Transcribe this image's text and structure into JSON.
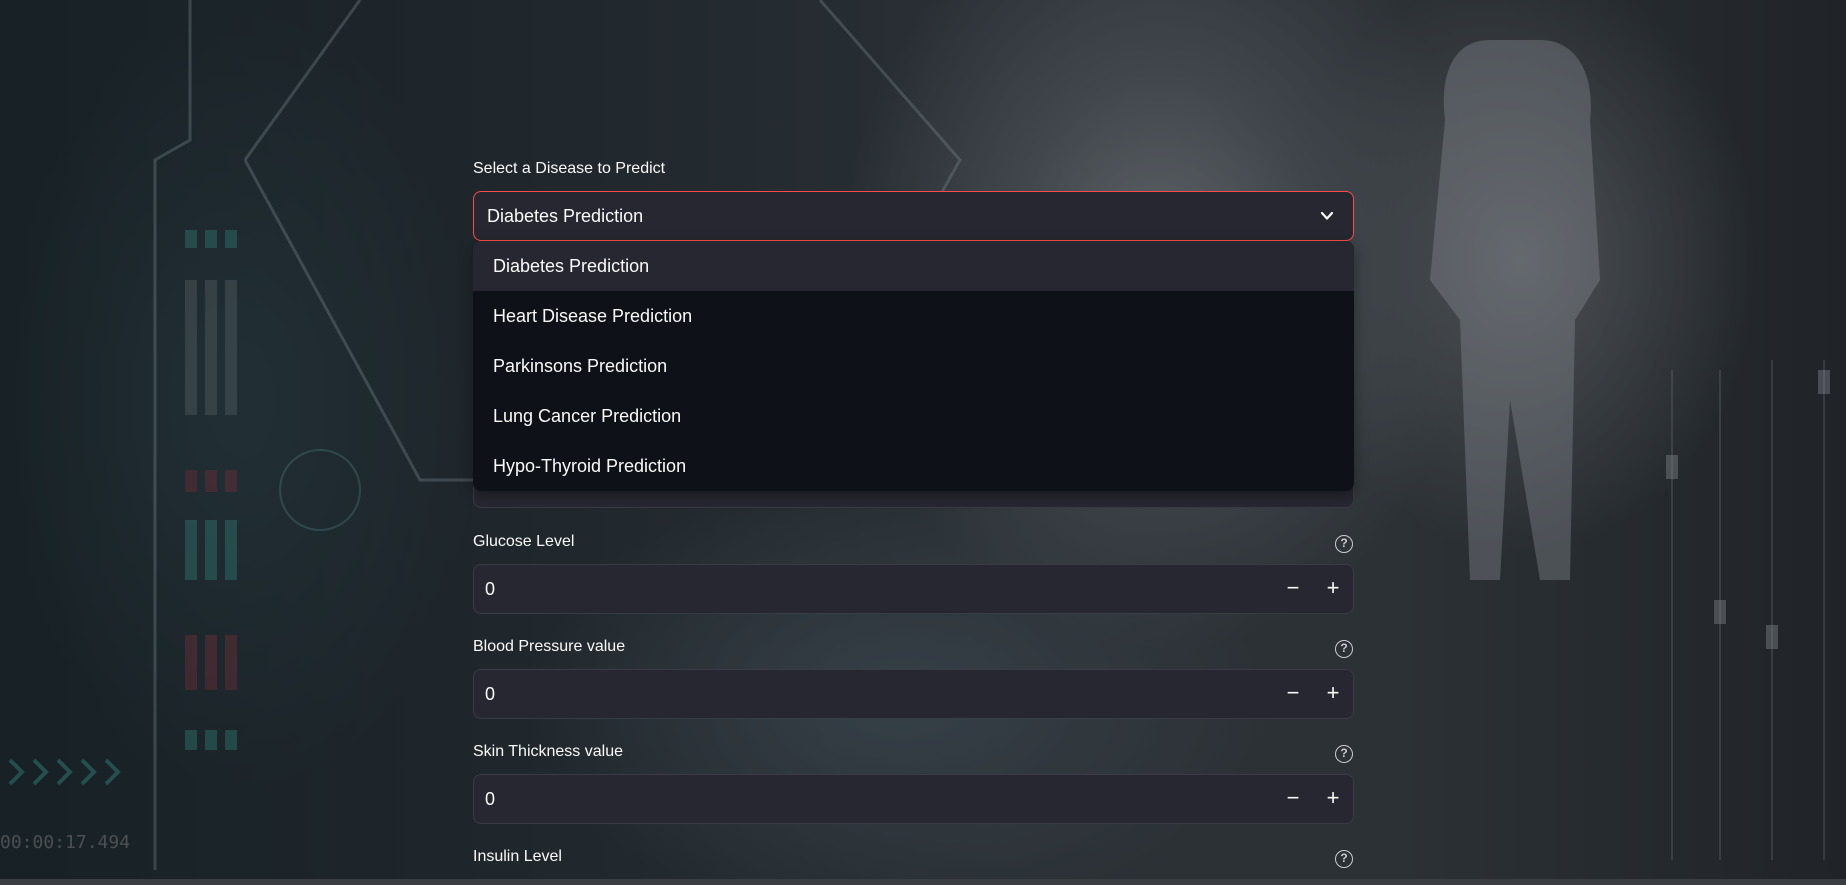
{
  "disease_select": {
    "label": "Select a Disease to Predict",
    "selected": "Diabetes Prediction",
    "options": [
      "Diabetes Prediction",
      "Heart Disease Prediction",
      "Parkinsons Prediction",
      "Lung Cancer Prediction",
      "Hypo-Thyroid Prediction"
    ]
  },
  "fields": [
    {
      "label": "Glucose Level",
      "value": "0"
    },
    {
      "label": "Blood Pressure value",
      "value": "0"
    },
    {
      "label": "Skin Thickness value",
      "value": "0"
    },
    {
      "label": "Insulin Level",
      "value": ""
    }
  ],
  "stepper": {
    "minus": "−",
    "plus": "+"
  },
  "help_glyph": "?",
  "background": {
    "timer_text": "00:00:17.494"
  },
  "colors": {
    "accent": "#ff4b4b",
    "input_bg": "#262730",
    "dropdown_bg": "#0e1117"
  }
}
